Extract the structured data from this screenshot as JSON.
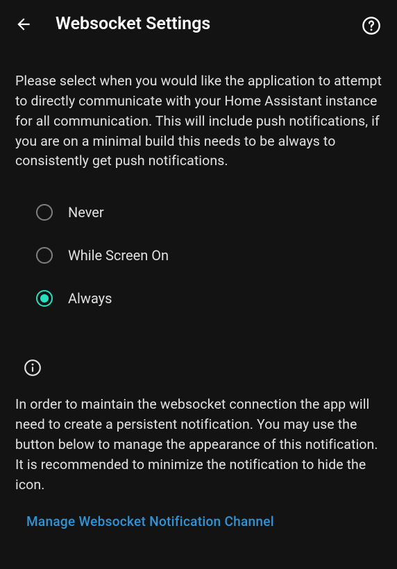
{
  "header": {
    "title": "Websocket Settings"
  },
  "description": "Please select when you would like the application to attempt to directly communicate with your Home Assistant instance for all communication. This will include push notifications, if you are on a minimal build this needs to be always to consistently get push notifications.",
  "options": [
    {
      "label": "Never",
      "selected": false
    },
    {
      "label": "While Screen On",
      "selected": false
    },
    {
      "label": "Always",
      "selected": true
    }
  ],
  "info_text": "In order to maintain the websocket connection the app will need to create a persistent notification. You may use the button below to manage the appearance of this notification. It is recommended to minimize the notification to hide the icon.",
  "link_label": "Manage Websocket Notification Channel"
}
